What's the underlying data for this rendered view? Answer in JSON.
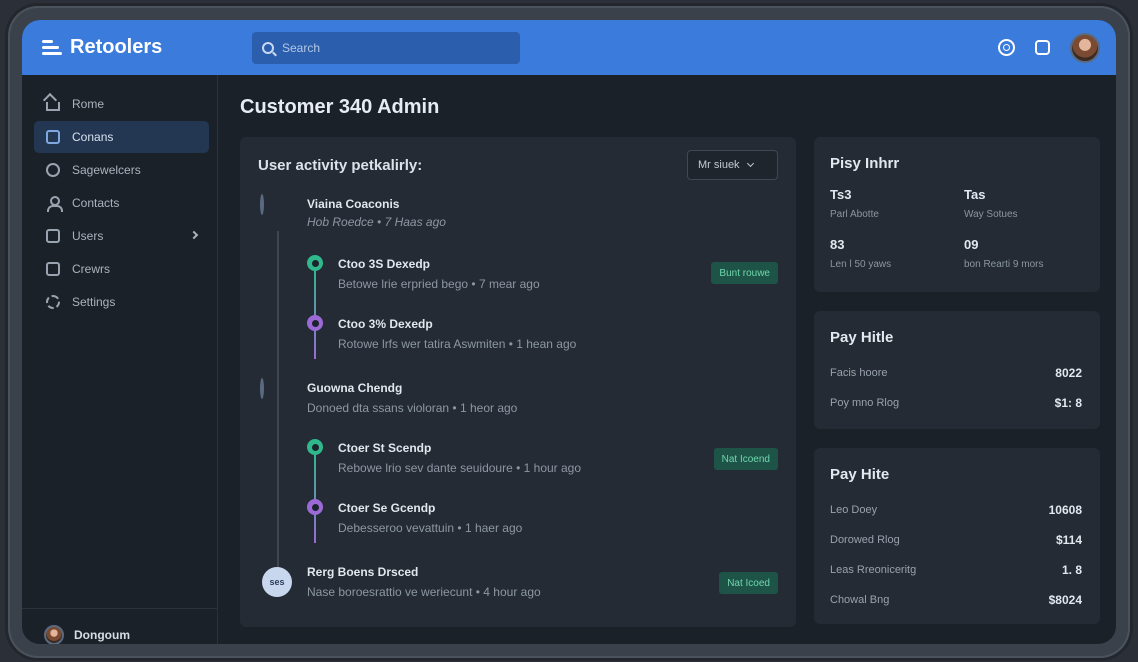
{
  "app": {
    "name": "Retoolers"
  },
  "search": {
    "placeholder": "Search"
  },
  "header": {
    "icons": [
      "settings-circle-icon",
      "window-icon",
      "user-avatar"
    ]
  },
  "sidebar": {
    "items": [
      {
        "label": "Rome",
        "icon": "home-icon"
      },
      {
        "label": "Conans",
        "icon": "box-icon",
        "active": true
      },
      {
        "label": "Sagewelcers",
        "icon": "ring-icon"
      },
      {
        "label": "Contacts",
        "icon": "person-icon"
      },
      {
        "label": "Users",
        "icon": "box-icon",
        "has_submenu": true
      },
      {
        "label": "Crewrs",
        "icon": "box-icon"
      },
      {
        "label": "Settings",
        "icon": "gear-icon"
      }
    ],
    "footer": {
      "user": "Dongoum"
    }
  },
  "page": {
    "title": "Customer 340 Admin"
  },
  "activity": {
    "title": "User activity petkalirly:",
    "filter": "Mr siuek",
    "groups": [
      {
        "name": "Viaina Coaconis",
        "sub": "Hob Roedce  •  7 Haas ago",
        "children": [
          {
            "name": "Ctoo 3S Dexedp",
            "sub": "Betowe lrie erpried bego  •  7 mear ago",
            "dot": "green",
            "tag": "Bunt rouwe"
          },
          {
            "name": "Ctoo 3% Dexedp",
            "sub": "Rotowe lrfs wer tatira Aswmiten  •  1 hean ago",
            "dot": "purple"
          }
        ]
      },
      {
        "name": "Guowna Chendg",
        "sub": "Donoed dta ssans violoran  •  1 heor ago",
        "children": [
          {
            "name": "Ctoer St Scendp",
            "sub": "Rebowe lrio sev dante seuidoure  •  1 hour ago",
            "dot": "green",
            "tag": "Nat Icoend"
          },
          {
            "name": "Ctoer Se Gcendp",
            "sub": "Debesseroo vevattuin  •  1 haer ago",
            "dot": "purple"
          }
        ]
      },
      {
        "name": "Rerg Boens Drsced",
        "sub": "Nase boroesrattio ve weriecunt  •  4 hour ago",
        "avatar_text": "ses",
        "tag": "Nat Icoed"
      }
    ]
  },
  "panels": {
    "info": {
      "title": "Pisy Inhrr",
      "stats": [
        {
          "value": "Ts3",
          "label": "Parl Abotte"
        },
        {
          "value": "Tas",
          "label": "Way Sotues"
        },
        {
          "value": "83",
          "label": "Len l 50 yaws"
        },
        {
          "value": "09",
          "label": "bon Rearti 9 mors"
        }
      ]
    },
    "pay1": {
      "title": "Pay Hitle",
      "rows": [
        {
          "label": "Facis hoore",
          "value": "8022"
        },
        {
          "label": "Poy mno Rlog",
          "value": "$1: 8"
        }
      ]
    },
    "pay2": {
      "title": "Pay Hite",
      "rows": [
        {
          "label": "Leo Doey",
          "value": "10608"
        },
        {
          "label": "Dorowed Rlog",
          "value": "$114"
        },
        {
          "label": "Leas Rreoniceritg",
          "value": "1. 8"
        },
        {
          "label": "Chowal Bng",
          "value": "$8024"
        }
      ]
    }
  },
  "colors": {
    "accent": "#3a7bdc",
    "active_nav": "#243752",
    "tag_bg": "#1e5447",
    "tag_text": "#6ed7ad",
    "dot_green": "#2fb88c",
    "dot_purple": "#9b6ad8"
  }
}
